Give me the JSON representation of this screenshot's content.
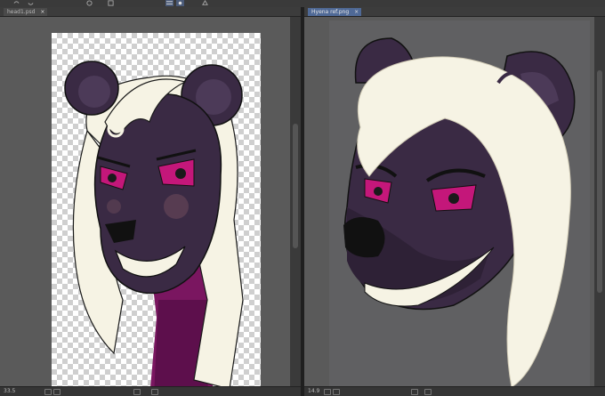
{
  "toolbar": {
    "icons": [
      "undo-icon",
      "redo-icon",
      "transform-icon",
      "select-icon",
      "layer-icon",
      "view-icon",
      "palette-icon"
    ]
  },
  "left_pane": {
    "tab_label": "head1.psd",
    "status_zoom": "33.5"
  },
  "right_pane": {
    "tab_label": "Hyena ref.png",
    "status_zoom": "14.9"
  },
  "colors": {
    "workspace": "#545454",
    "right_canvas_bg": "#606062",
    "fur_dark": "#3a2a44",
    "hair": "#f6f3e4",
    "eye_magenta": "#c4177a",
    "scarf_magenta": "#7a1660",
    "active_tab": "#4f6996"
  }
}
